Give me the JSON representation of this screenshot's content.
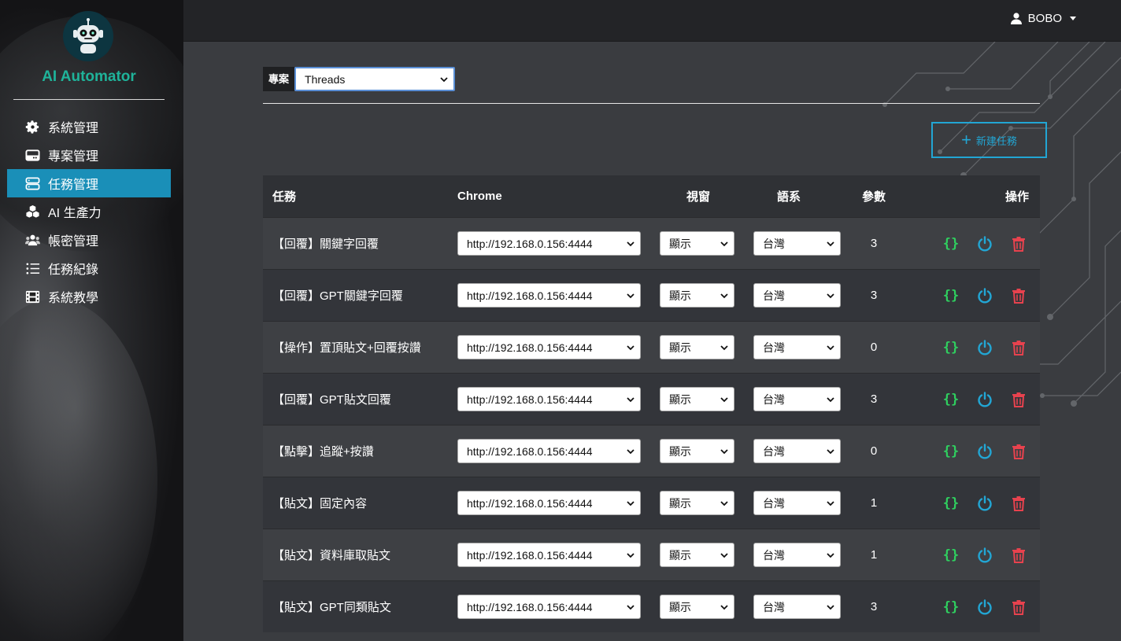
{
  "app": {
    "brand": "AI Automator",
    "user": "BOBO"
  },
  "sidebar": {
    "items": [
      {
        "label": "系統管理",
        "icon": "gear-icon"
      },
      {
        "label": "專案管理",
        "icon": "drive-icon"
      },
      {
        "label": "任務管理",
        "icon": "server-icon",
        "active": true
      },
      {
        "label": "AI 生產力",
        "icon": "cubes-icon"
      },
      {
        "label": "帳密管理",
        "icon": "users-icon"
      },
      {
        "label": "任務紀錄",
        "icon": "list-icon"
      },
      {
        "label": "系統教學",
        "icon": "film-icon"
      }
    ]
  },
  "project": {
    "label": "專案",
    "selected": "Threads"
  },
  "new_task_button": "新建任務",
  "table": {
    "headers": {
      "task": "任務",
      "chrome": "Chrome",
      "window": "視窗",
      "language": "語系",
      "params": "參數",
      "actions": "操作"
    },
    "rows": [
      {
        "task": "【回覆】關鍵字回覆",
        "chrome": "http://192.168.0.156:4444",
        "window": "顯示",
        "language": "台灣",
        "params": "3"
      },
      {
        "task": "【回覆】GPT關鍵字回覆",
        "chrome": "http://192.168.0.156:4444",
        "window": "顯示",
        "language": "台灣",
        "params": "3"
      },
      {
        "task": "【操作】置頂貼文+回覆按讚",
        "chrome": "http://192.168.0.156:4444",
        "window": "顯示",
        "language": "台灣",
        "params": "0"
      },
      {
        "task": "【回覆】GPT貼文回覆",
        "chrome": "http://192.168.0.156:4444",
        "window": "顯示",
        "language": "台灣",
        "params": "3"
      },
      {
        "task": "【點擊】追蹤+按讚",
        "chrome": "http://192.168.0.156:4444",
        "window": "顯示",
        "language": "台灣",
        "params": "0"
      },
      {
        "task": "【貼文】固定內容",
        "chrome": "http://192.168.0.156:4444",
        "window": "顯示",
        "language": "台灣",
        "params": "1"
      },
      {
        "task": "【貼文】資料庫取貼文",
        "chrome": "http://192.168.0.156:4444",
        "window": "顯示",
        "language": "台灣",
        "params": "1"
      },
      {
        "task": "【貼文】GPT同類貼文",
        "chrome": "http://192.168.0.156:4444",
        "window": "顯示",
        "language": "台灣",
        "params": "3"
      }
    ]
  },
  "colors": {
    "accent": "#1a8fb8",
    "brand": "#1fb39a",
    "code_icon": "#2fcf5f",
    "power_icon": "#22a6d4",
    "delete_icon": "#e8424e"
  }
}
